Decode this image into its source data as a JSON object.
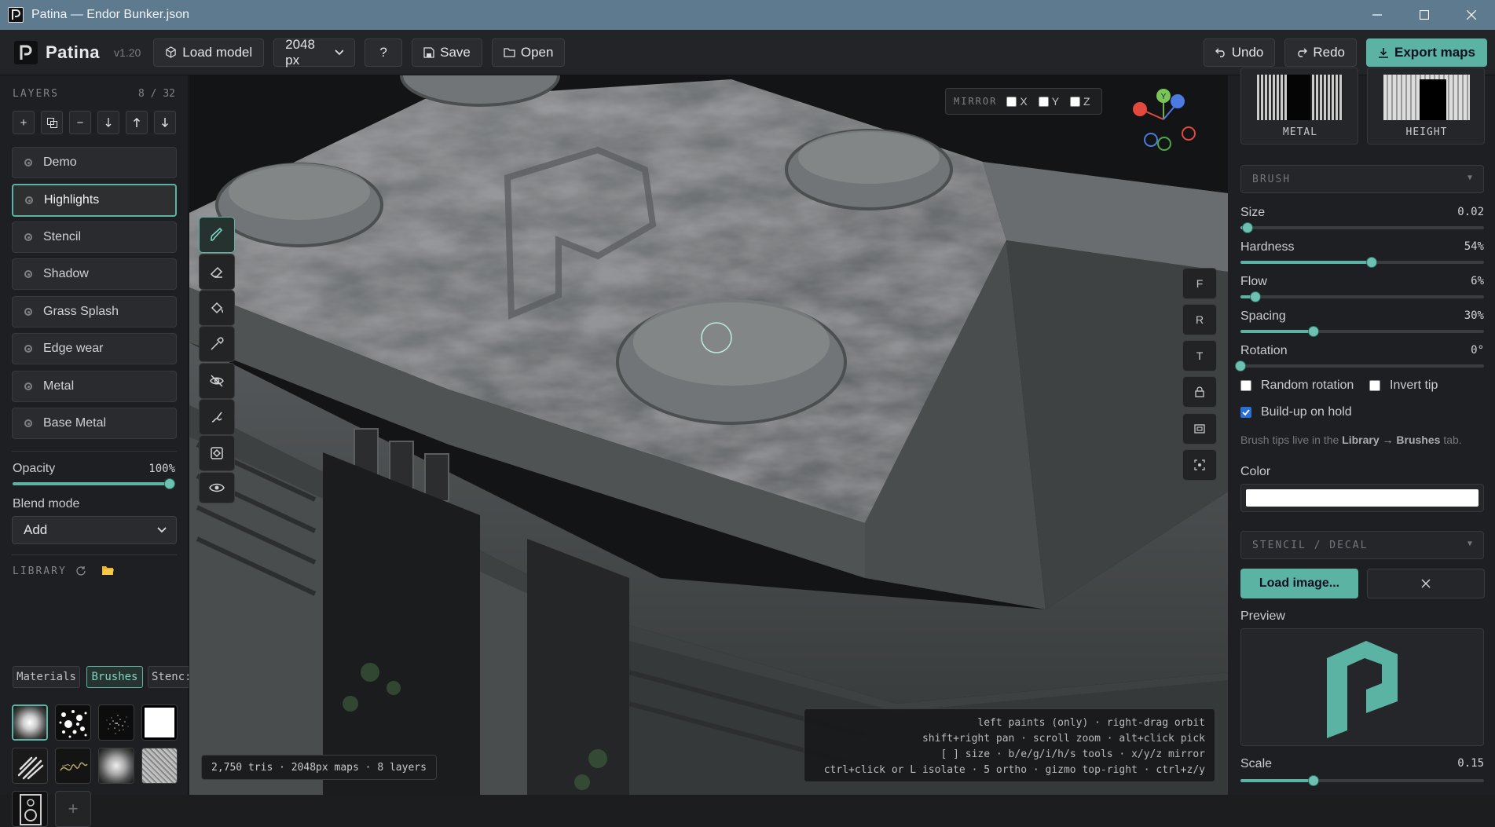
{
  "window": {
    "title": "Patina — Endor Bunker.json"
  },
  "toolbar": {
    "brand": "Patina",
    "logo_caption": "Patina",
    "version": "v1.20",
    "load_model": "Load model",
    "resolution": "2048 px",
    "help": "?",
    "save": "Save",
    "open": "Open",
    "undo": "Undo",
    "redo": "Redo",
    "export": "Export maps"
  },
  "layers": {
    "header": "LAYERS",
    "count": "8 / 32",
    "items": [
      {
        "label": "Demo"
      },
      {
        "label": "Highlights"
      },
      {
        "label": "Stencil"
      },
      {
        "label": "Shadow"
      },
      {
        "label": "Grass Splash"
      },
      {
        "label": "Edge wear"
      },
      {
        "label": "Metal"
      },
      {
        "label": "Base Metal"
      }
    ],
    "selected": "Highlights",
    "opacity_label": "Opacity",
    "opacity_value": "100%",
    "opacity": 1.0,
    "blend_label": "Blend mode",
    "blend_value": "Add"
  },
  "library": {
    "header": "LIBRARY",
    "tabs": [
      "Materials",
      "Brushes",
      "Stenc:"
    ],
    "active_tab": "Brushes"
  },
  "viewport": {
    "mirror_label": "MIRROR",
    "mirror_axes": [
      "X",
      "Y",
      "Z"
    ],
    "gizmo_y": "Y",
    "view_buttons": [
      "F",
      "R",
      "T"
    ],
    "stats": "2,750 tris · 2048px maps · 8 layers",
    "help_lines": [
      "left paints (only) · right-drag orbit",
      "shift+right pan · scroll zoom · alt+click pick",
      "[ ] size · b/e/g/i/h/s tools · x/y/z mirror",
      "ctrl+click or L isolate · 5 ortho · gizmo top-right · ctrl+z/y"
    ]
  },
  "maps": {
    "metal": "METAL",
    "height": "HEIGHT"
  },
  "brush": {
    "header": "BRUSH",
    "size_label": "Size",
    "size_value": "0.02",
    "size": 0.02,
    "hardness_label": "Hardness",
    "hardness_value": "54%",
    "hardness": 0.54,
    "flow_label": "Flow",
    "flow_value": "6%",
    "flow": 0.06,
    "spacing_label": "Spacing",
    "spacing_value": "30%",
    "spacing": 0.3,
    "rotation_label": "Rotation",
    "rotation_value": "0°",
    "rotation": 0,
    "random_rotation": "Random rotation",
    "invert_tip": "Invert tip",
    "buildup": "Build-up on hold",
    "tip_note_a": "Brush tips live in the ",
    "tip_note_b": "Library → Brushes",
    "tip_note_c": " tab.",
    "color_label": "Color",
    "color": "#ffffff"
  },
  "stencil": {
    "header": "STENCIL / DECAL",
    "load_image": "Load image...",
    "preview_label": "Preview",
    "scale_label": "Scale",
    "scale_value": "0.15",
    "scale": 0.15
  },
  "colors": {
    "accent": "#5bb3a3",
    "titlebar": "#5d7a8e"
  }
}
